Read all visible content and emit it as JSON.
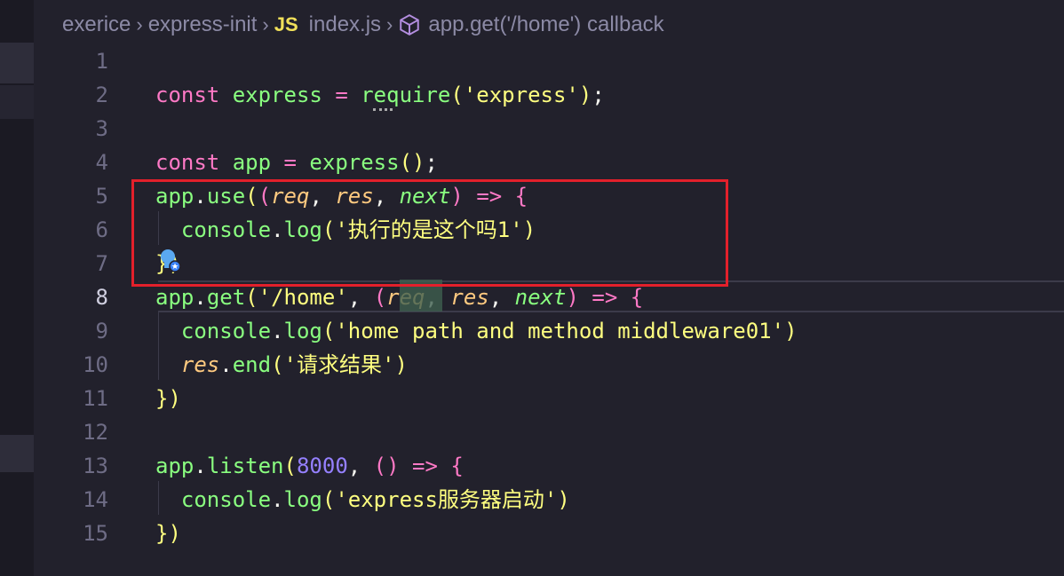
{
  "breadcrumb": {
    "folder1": "exerice",
    "folder2": "express-init",
    "file_icon": "JS",
    "file": "index.js",
    "symbol_icon": "symbol-method-icon",
    "symbol": "app.get('/home') callback"
  },
  "lines": [
    {
      "n": "1"
    },
    {
      "n": "2",
      "t": [
        "const",
        " ",
        "express",
        " ",
        "=",
        " ",
        "require",
        "(",
        "'express'",
        ")",
        ";"
      ]
    },
    {
      "n": "3"
    },
    {
      "n": "4",
      "t": [
        "const",
        " ",
        "app",
        " ",
        "=",
        " ",
        "express",
        "(",
        ")",
        ";"
      ]
    },
    {
      "n": "5",
      "t": [
        "app",
        ".",
        "use",
        "(",
        "(",
        "req",
        ", ",
        "res",
        ", ",
        "next",
        ")",
        " ",
        "=>",
        " ",
        "{"
      ]
    },
    {
      "n": "6",
      "t": [
        "  ",
        "console",
        ".",
        "log",
        "(",
        "'执行的是这个吗1'",
        ")"
      ]
    },
    {
      "n": "7",
      "t": [
        "})"
      ]
    },
    {
      "n": "8",
      "t": [
        "app",
        ".",
        "get",
        "(",
        "'/home'",
        ", ",
        "(",
        "req",
        ", ",
        "res",
        ", ",
        "next",
        ")",
        " ",
        "=>",
        " ",
        "{"
      ]
    },
    {
      "n": "9",
      "t": [
        "  ",
        "console",
        ".",
        "log",
        "(",
        "'home path and method middleware01'",
        ")"
      ]
    },
    {
      "n": "10",
      "t": [
        "  ",
        "res",
        ".",
        "end",
        "(",
        "'请求结果'",
        ")"
      ]
    },
    {
      "n": "11",
      "t": [
        "})"
      ]
    },
    {
      "n": "12"
    },
    {
      "n": "13",
      "t": [
        "app",
        ".",
        "listen",
        "(",
        "8000",
        ", ",
        "(",
        ")",
        " ",
        "=>",
        " ",
        "{"
      ]
    },
    {
      "n": "14",
      "t": [
        "  ",
        "console",
        ".",
        "log",
        "(",
        "'express服务器启动'",
        ")"
      ]
    },
    {
      "n": "15",
      "t": [
        "})"
      ]
    }
  ],
  "active_line": "8",
  "colors": {
    "background": "#22212c",
    "keyword": "#ff79c6",
    "function": "#8aff80",
    "string": "#ffff80",
    "parameter": "#ffca80",
    "number": "#9580ff",
    "annotation_box": "#e3202b"
  },
  "icons": {
    "lightbulb": "lightbulb-autofix-icon"
  }
}
